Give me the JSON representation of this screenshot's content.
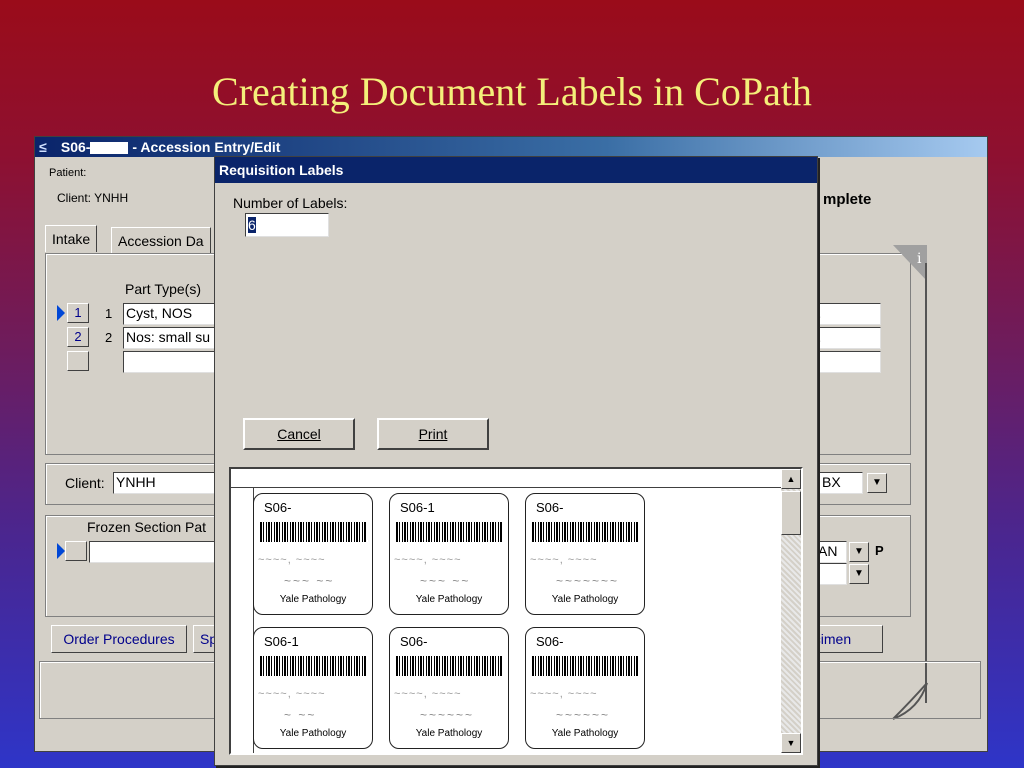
{
  "slide": {
    "title": "Creating Document Labels in CoPath"
  },
  "window": {
    "title_prefix": "S06-",
    "title_suffix": " - Accession Entry/Edit",
    "patient_label": "Patient:",
    "client_label": "Client:",
    "client_value": "YNHH",
    "status_text": "mplete",
    "tabs": [
      "Intake",
      "Accession Da"
    ],
    "part_types_header": "Part Type(s)",
    "parts": [
      {
        "btn": "1",
        "num": "1",
        "type": "Cyst, NOS"
      },
      {
        "btn": "2",
        "num": "2",
        "type": "Nos: small su"
      },
      {
        "btn": "",
        "num": "",
        "type": ""
      }
    ],
    "client_field_label": "Client:",
    "client_field_value": "YNHH",
    "frozen_section_label": "Frozen Section Pat",
    "right_dropdown_1": "N BX",
    "right_dropdown_2": "AN",
    "right_p_label": "P",
    "order_procedures_label": "Order Procedures",
    "sp_button_label": "Sp",
    "specimen_button_label": "ecimen",
    "info_icon": "i"
  },
  "dialog": {
    "title": "Requisition Labels",
    "number_of_labels_label": "Number of Labels:",
    "number_of_labels_value": "6",
    "cancel_label": "Cancel",
    "print_label": "Print"
  },
  "labels": [
    {
      "accession": "S06-",
      "org": "Yale Pathology"
    },
    {
      "accession": "S06-1",
      "org": "Yale Pathology"
    },
    {
      "accession": "S06-",
      "org": "Yale Pathology"
    },
    {
      "accession": "S06-1",
      "org": "Yale Pathology"
    },
    {
      "accession": "S06-",
      "org": "Yale Pathology"
    },
    {
      "accession": "S06-",
      "org": "Yale Pathology"
    }
  ]
}
